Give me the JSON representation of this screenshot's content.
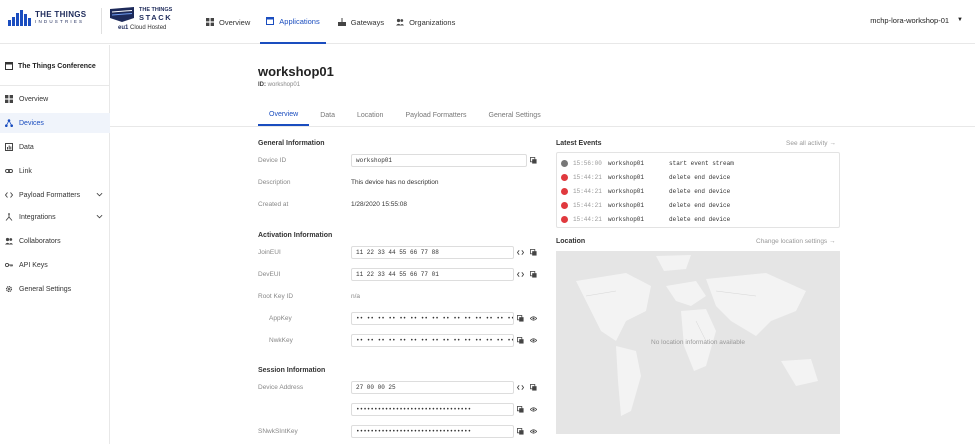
{
  "header": {
    "tti_logo": {
      "line1": "THE THINGS",
      "line2": "INDUSTRIES"
    },
    "stack_logo": {
      "line1": "THE THINGS",
      "line2": "STACK"
    },
    "cluster": "eu1",
    "hosting": "Cloud Hosted",
    "nav": [
      {
        "label": "Overview",
        "icon": "grid-icon"
      },
      {
        "label": "Applications",
        "icon": "window-icon",
        "active": true
      },
      {
        "label": "Gateways",
        "icon": "gateway-icon"
      },
      {
        "label": "Organizations",
        "icon": "people-icon"
      }
    ],
    "user": "mchp-lora-workshop-01"
  },
  "sidebar": {
    "app_name": "The Things Conference",
    "items": [
      {
        "label": "Overview",
        "icon": "grid-icon"
      },
      {
        "label": "Devices",
        "icon": "devices-icon",
        "active": true
      },
      {
        "label": "Data",
        "icon": "data-icon"
      },
      {
        "label": "Link",
        "icon": "link-icon"
      },
      {
        "label": "Payload Formatters",
        "icon": "code-icon",
        "expandable": true
      },
      {
        "label": "Integrations",
        "icon": "integrations-icon",
        "expandable": true
      },
      {
        "label": "Collaborators",
        "icon": "people-icon"
      },
      {
        "label": "API Keys",
        "icon": "key-icon"
      },
      {
        "label": "General Settings",
        "icon": "gear-icon"
      }
    ]
  },
  "device": {
    "title": "workshop01",
    "id_label": "ID:",
    "id_value": "workshop01"
  },
  "tabs": [
    "Overview",
    "Data",
    "Location",
    "Payload Formatters",
    "General Settings"
  ],
  "general": {
    "heading": "General Information",
    "device_id_label": "Device ID",
    "device_id": "workshop01",
    "description_label": "Description",
    "description": "This device has no description",
    "created_label": "Created at",
    "created": "1/28/2020 15:55:08"
  },
  "activation": {
    "heading": "Activation Information",
    "join_eui_label": "JoinEUI",
    "join_eui": "11 22 33 44 55 66 77 88",
    "dev_eui_label": "DevEUI",
    "dev_eui": "11 22 33 44 55 66 77 01",
    "root_key_label": "Root Key ID",
    "root_key": "n/a",
    "app_key_label": "AppKey",
    "app_key": "•• •• •• •• •• •• •• •• •• •• •• •• •• •• •• ••",
    "nwk_key_label": "NwkKey",
    "nwk_key": "•• •• •• •• •• •• •• •• •• •• •• •• •• •• •• ••"
  },
  "session": {
    "heading": "Session Information",
    "address_label": "Device Address",
    "address": "27 00 00 25",
    "key1": "••••••••••••••••••••••••••••••••",
    "snwk_label": "SNwkSIntKey",
    "snwk": "••••••••••••••••••••••••••••••••"
  },
  "events": {
    "heading": "Latest Events",
    "see_all": "See all activity →",
    "rows": [
      {
        "time": "15:56:00",
        "device": "workshop01",
        "message": "start event stream",
        "status": "info",
        "color": "#777777"
      },
      {
        "time": "15:44:21",
        "device": "workshop01",
        "message": "delete end device",
        "status": "error",
        "color": "#e0393e"
      },
      {
        "time": "15:44:21",
        "device": "workshop01",
        "message": "delete end device",
        "status": "error",
        "color": "#e0393e"
      },
      {
        "time": "15:44:21",
        "device": "workshop01",
        "message": "delete end device",
        "status": "error",
        "color": "#e0393e"
      },
      {
        "time": "15:44:21",
        "device": "workshop01",
        "message": "delete end device",
        "status": "error",
        "color": "#e0393e"
      }
    ]
  },
  "location": {
    "heading": "Location",
    "change": "Change location settings →",
    "empty": "No location information available"
  },
  "colors": {
    "accent": "#1a4dbf",
    "error": "#e0393e",
    "brand_dark": "#1d2a5a"
  }
}
